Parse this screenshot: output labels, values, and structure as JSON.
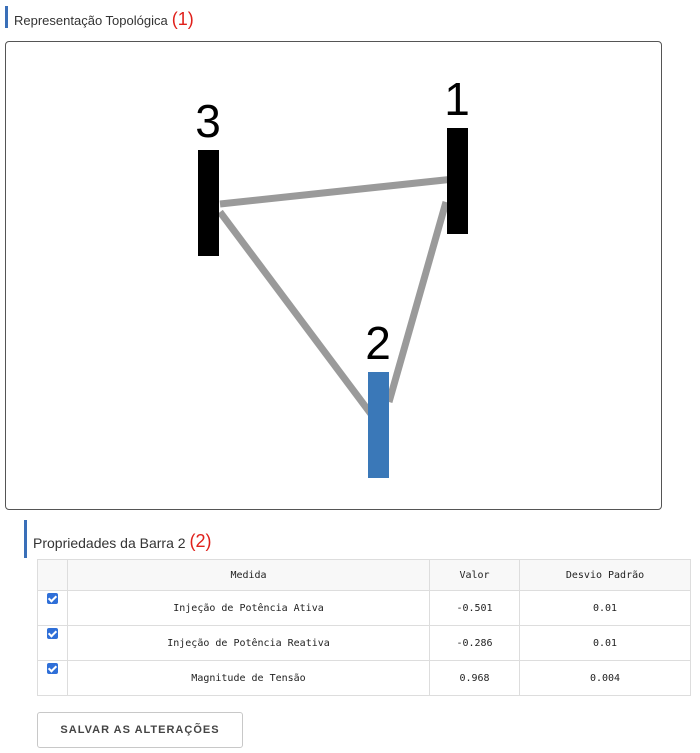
{
  "topology": {
    "title": "Representação Topológica",
    "number": "(1)",
    "buses": [
      {
        "label": "1",
        "color": "#000000",
        "selected": false
      },
      {
        "label": "2",
        "color": "#3a78b8",
        "selected": true
      },
      {
        "label": "3",
        "color": "#000000",
        "selected": false
      }
    ],
    "line_color": "#9a9a9a"
  },
  "properties": {
    "title": "Propriedades da Barra 2",
    "number": "(2)",
    "headers": {
      "medida": "Medida",
      "valor": "Valor",
      "desvio": "Desvio Padrão"
    },
    "rows": [
      {
        "checked": true,
        "medida": "Injeção de Potência Ativa",
        "valor": "-0.501",
        "desvio": "0.01"
      },
      {
        "checked": true,
        "medida": "Injeção de Potência Reativa",
        "valor": "-0.286",
        "desvio": "0.01"
      },
      {
        "checked": true,
        "medida": "Magnitude de Tensão",
        "valor": "0.968",
        "desvio": "0.004"
      }
    ]
  },
  "save_label": "SALVAR AS ALTERAÇÕES"
}
